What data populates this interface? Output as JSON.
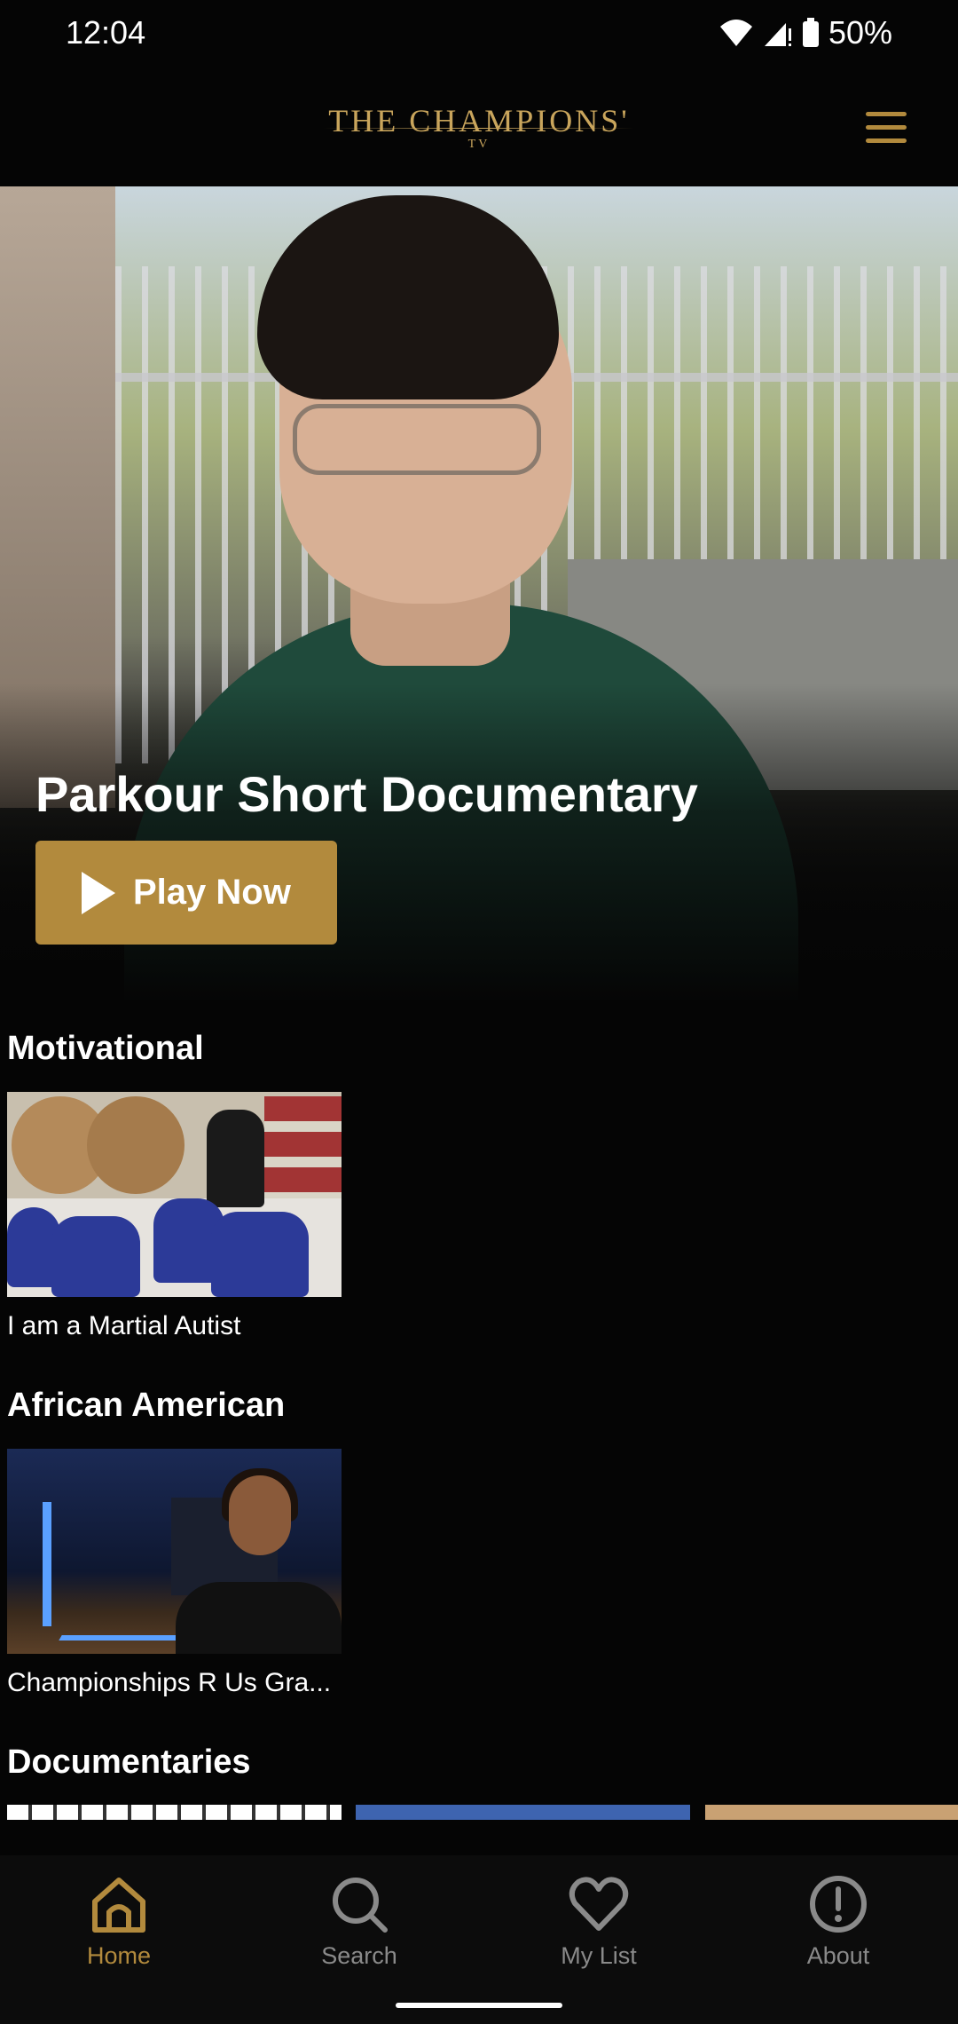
{
  "status_bar": {
    "time": "12:04",
    "battery": "50%"
  },
  "app_bar": {
    "logo_main": "THE CHAMPIONS'",
    "logo_sub": "TV"
  },
  "hero": {
    "title": "Parkour Short Documentary",
    "play_label": "Play Now"
  },
  "sections": [
    {
      "title": "Motivational",
      "items": [
        {
          "caption": "I am a Martial Autist"
        }
      ]
    },
    {
      "title": "African American",
      "items": [
        {
          "caption": "Championships R Us Gra..."
        }
      ]
    },
    {
      "title": "Documentaries",
      "items": [
        {
          "caption": ""
        },
        {
          "caption": ""
        },
        {
          "caption": ""
        }
      ]
    }
  ],
  "bottom_nav": [
    {
      "label": "Home",
      "icon": "home-icon",
      "active": true
    },
    {
      "label": "Search",
      "icon": "search-icon",
      "active": false
    },
    {
      "label": "My List",
      "icon": "heart-icon",
      "active": false
    },
    {
      "label": "About",
      "icon": "info-icon",
      "active": false
    }
  ],
  "colors": {
    "accent": "#b28a3d",
    "inactive": "#8a8a8a",
    "background": "#050505"
  }
}
